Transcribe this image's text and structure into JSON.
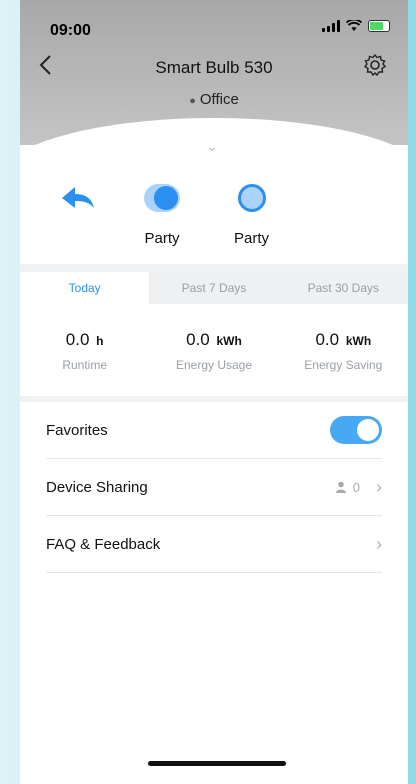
{
  "status_bar": {
    "time": "09:00"
  },
  "header": {
    "title": "Smart Bulb 530",
    "location": "Office"
  },
  "quick_actions": [
    {
      "label": ""
    },
    {
      "label": "Party"
    },
    {
      "label": "Party"
    }
  ],
  "tabs": [
    {
      "label": "Today",
      "active": true
    },
    {
      "label": "Past 7 Days",
      "active": false
    },
    {
      "label": "Past 30 Days",
      "active": false
    }
  ],
  "stats": [
    {
      "value": "0.0",
      "unit": "h",
      "label": "Runtime"
    },
    {
      "value": "0.0",
      "unit": "kWh",
      "label": "Energy Usage"
    },
    {
      "value": "0.0",
      "unit": "kWh",
      "label": "Energy Saving"
    }
  ],
  "list": {
    "favorites": {
      "label": "Favorites",
      "enabled": true
    },
    "device_sharing": {
      "label": "Device Sharing",
      "count": "0"
    },
    "faq": {
      "label": "FAQ & Feedback"
    }
  },
  "colors": {
    "accent": "#2b8ff0",
    "light_accent": "#a9d3fb",
    "header_gray": "#b5b5b5"
  },
  "icons": [
    "back-arrow-icon",
    "gear-icon",
    "location-pin-icon",
    "undo-arrow-icon",
    "person-icon",
    "chevron-right-icon",
    "chevron-down-icon"
  ]
}
